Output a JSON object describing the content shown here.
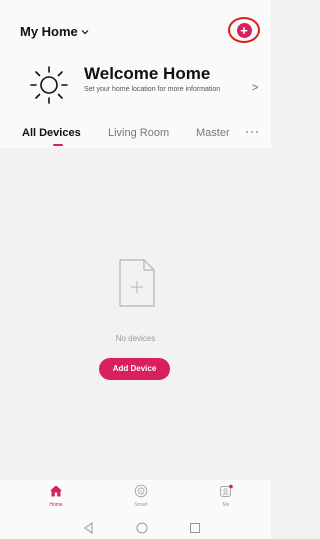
{
  "header": {
    "home_label": "My Home",
    "add_icon": "plus-circle-icon",
    "accent_color": "#d81f5f"
  },
  "welcome": {
    "title": "Welcome Home",
    "subtitle": "Set your home location for more information",
    "arrow": ">"
  },
  "tabs": {
    "items": [
      {
        "label": "All Devices",
        "active": true
      },
      {
        "label": "Living Room",
        "active": false
      },
      {
        "label": "Master",
        "active": false
      }
    ],
    "more": "···"
  },
  "main": {
    "empty_text": "No devices",
    "add_button": "Add Device"
  },
  "bottom_nav": {
    "items": [
      {
        "label": "Home",
        "icon": "home-icon",
        "active": true
      },
      {
        "label": "Smart",
        "icon": "smart-icon",
        "active": false
      },
      {
        "label": "Me",
        "icon": "me-icon",
        "active": false
      }
    ]
  },
  "system_nav": [
    "back-icon",
    "home-circle-icon",
    "recents-icon"
  ]
}
